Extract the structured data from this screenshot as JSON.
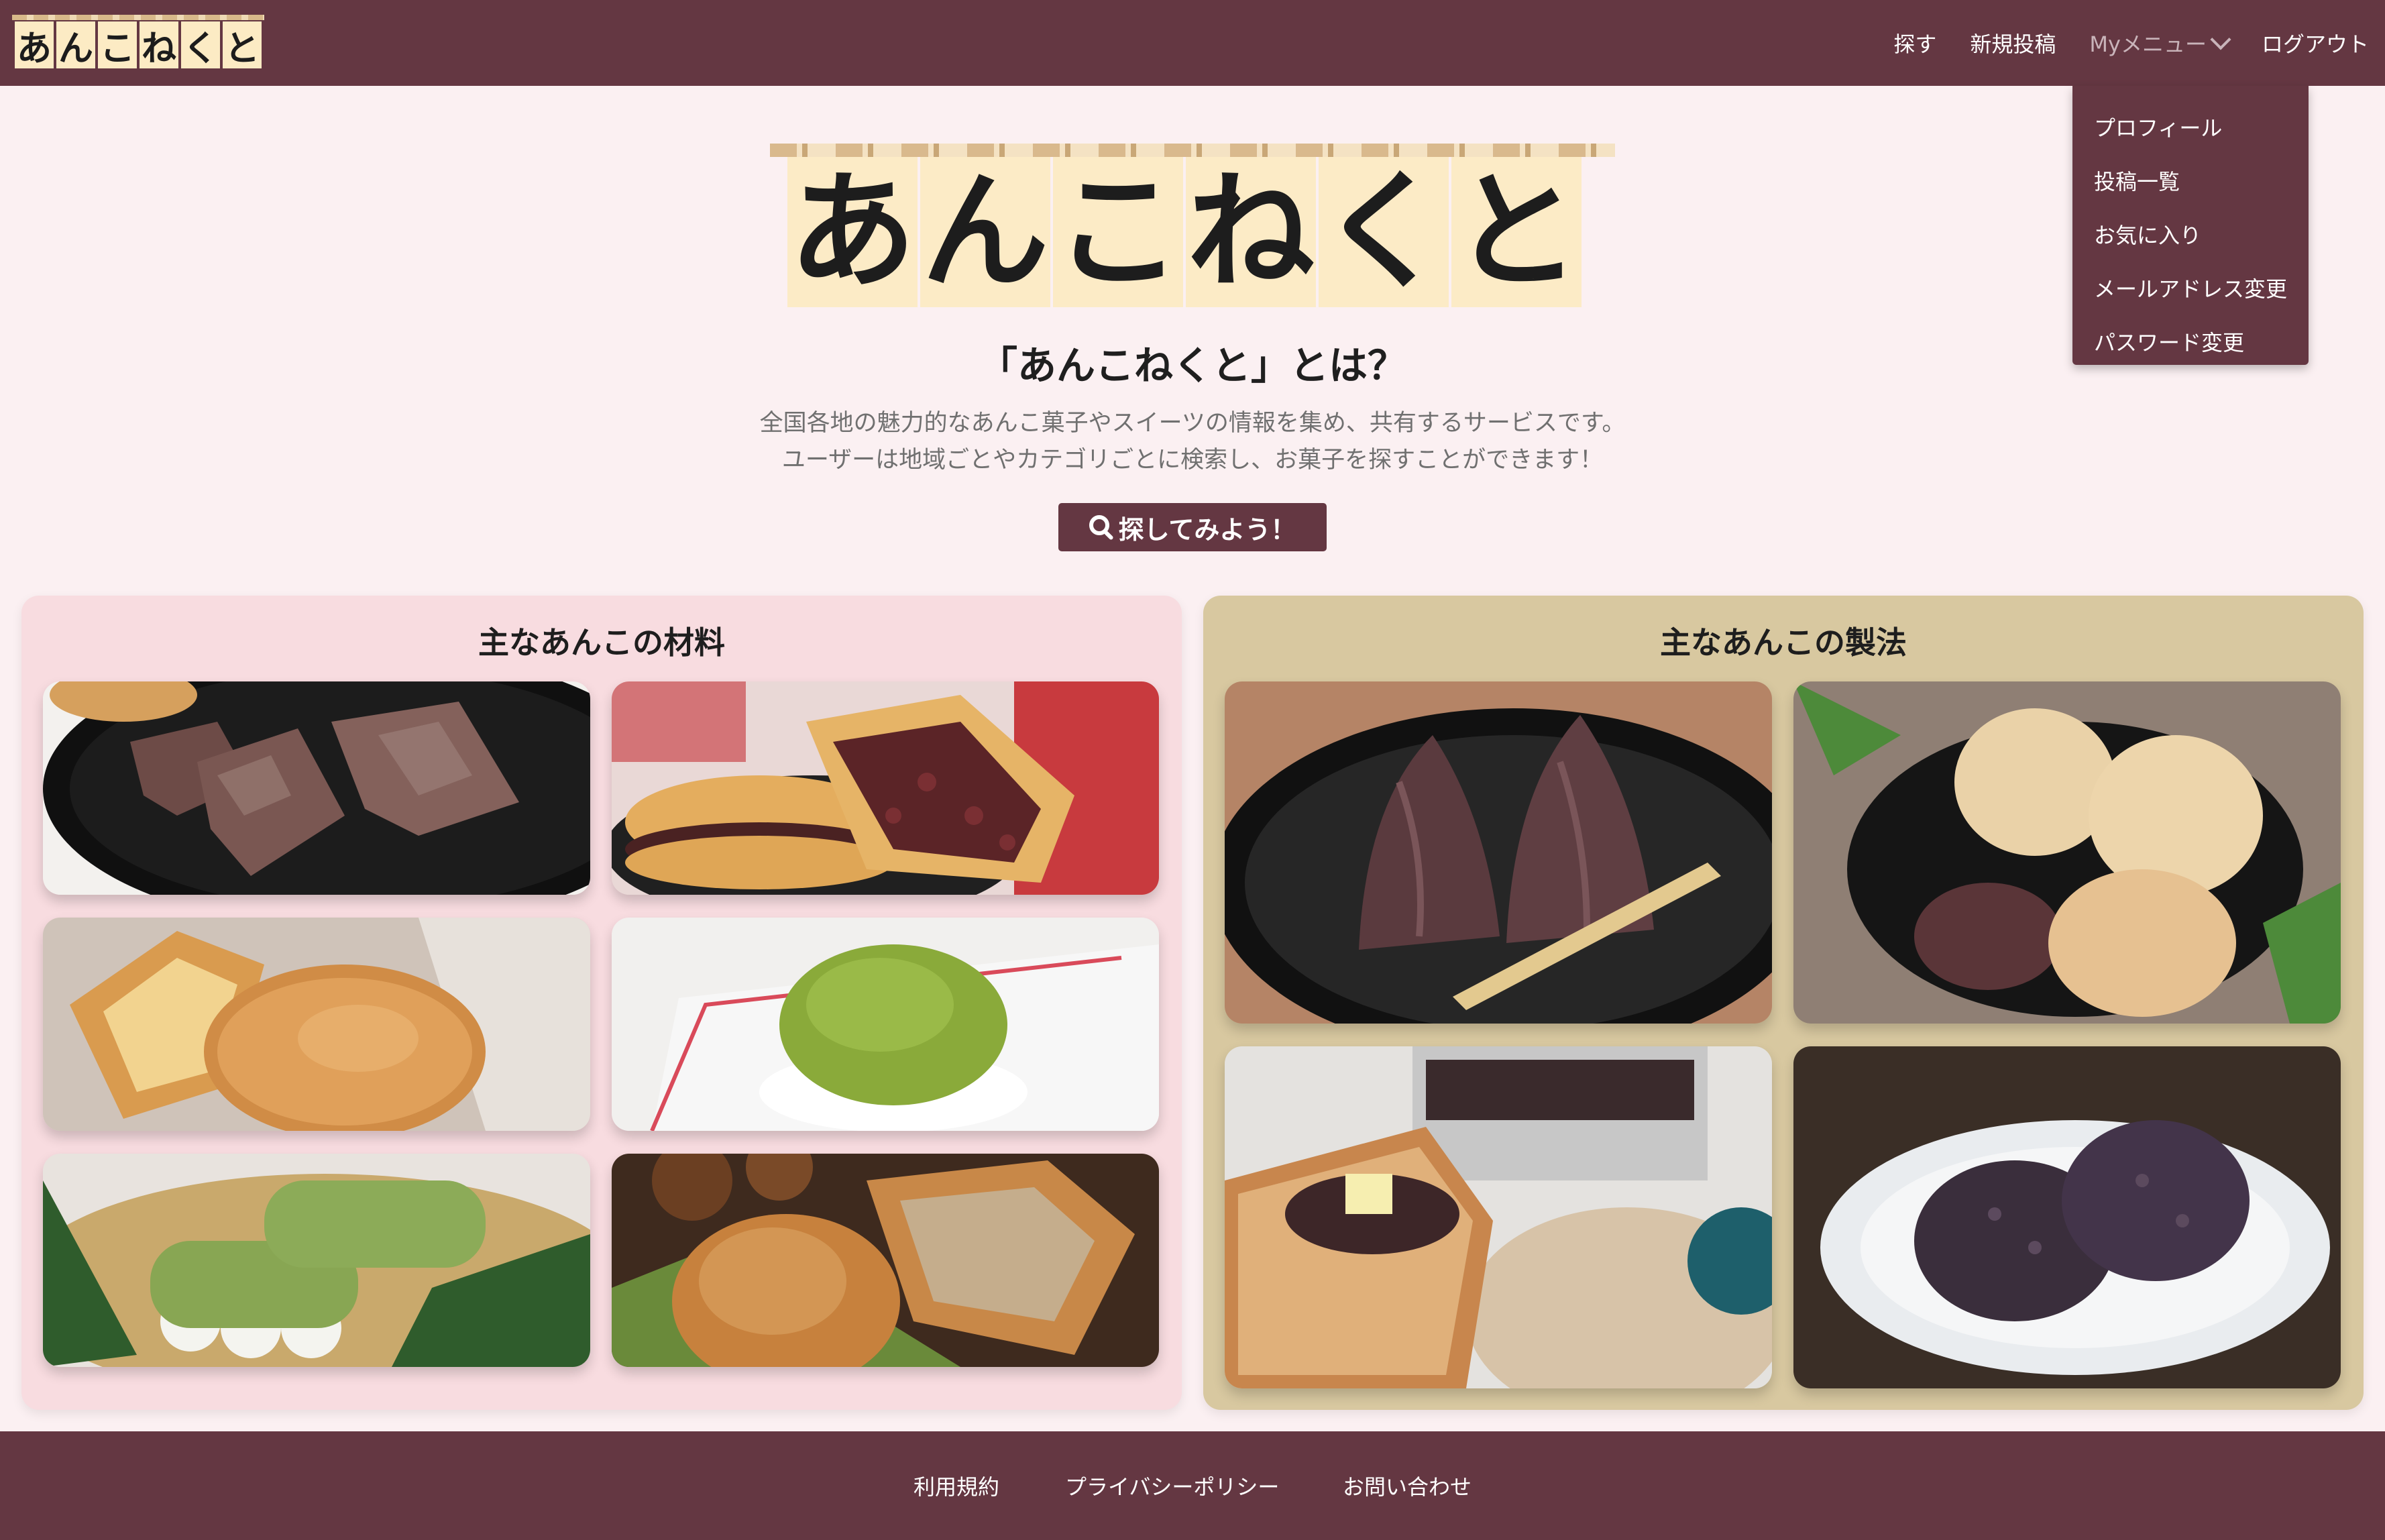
{
  "header": {
    "logo_chars": [
      "あ",
      "ん",
      "こ",
      "ね",
      "く",
      "と"
    ],
    "nav": {
      "search": "探す",
      "new_post": "新規投稿",
      "my_menu": "Myメニュー",
      "logout": "ログアウト"
    },
    "dropdown": {
      "items": [
        "プロフィール",
        "投稿一覧",
        "お気に入り",
        "メールアドレス変更",
        "パスワード変更"
      ]
    }
  },
  "hero": {
    "title_chars": [
      "あ",
      "ん",
      "こ",
      "ね",
      "く",
      "と"
    ],
    "about_title": "「あんこねくと」とは？",
    "description": [
      "全国各地の魅力的なあんこ菓子やスイーツの情報を集め、共有するサービスです。",
      "ユーザーは地域ごとやカテゴリごとに検索し、お菓子を探すことができます！"
    ],
    "search_button": "探してみよう！"
  },
  "sections": {
    "materials": {
      "title": "主なあんこの材料"
    },
    "methods": {
      "title": "主なあんこの製法"
    }
  },
  "footer": {
    "terms": "利用規約",
    "privacy": "プライバシーポリシー",
    "contact": "お問い合わせ"
  },
  "colors": {
    "brand": "#643742",
    "background": "#fbf0f2",
    "materials_panel": "#f8dce0",
    "methods_panel": "#d8c8a0",
    "noren": "#fcebc6"
  }
}
